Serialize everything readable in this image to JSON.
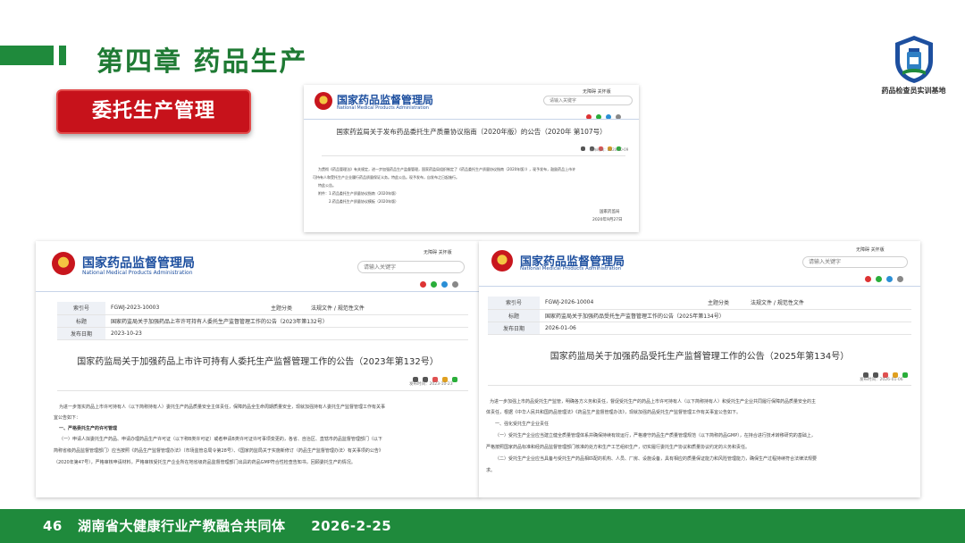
{
  "header": {
    "chapter_title": "第四章  药品生产",
    "section_label": "委托生产管理",
    "logo_caption": "药品检查员实训基地"
  },
  "nmpa": {
    "name_cn": "国家药品监督管理局",
    "name_en": "National Medical Products Administration",
    "toplinks": "无障碍  关怀版",
    "search_placeholder": "请输入关键字"
  },
  "doc1": {
    "title": "国家药监局关于发布药品委托生产质量协议指南（2020年版）的公告（2020年 第107号）",
    "publish_date": "发布时间：2020-10-09",
    "body": [
      "为贯彻《药品管理法》有关规定，进一步加强药品生产监督管理，国家药监局组织制定了《药品委托生产质量协议指南（2020年版）》，现予发布，鼓励药品上市许",
      "可持有人和受托生产企业履行药品质量保证义务。特此公告。现予发布，自发布之日起施行。",
      "特此公告。",
      "附件：1.药品委托生产质量协议指南（2020年版）",
      "2.药品委托生产质量协议模板（2020年版）"
    ],
    "sign_org": "国家药监局",
    "sign_date": "2020年9月27日"
  },
  "doc2": {
    "meta": {
      "index_label": "索引号",
      "index_value": "FGWJ-2023-10003",
      "category_label": "主题分类",
      "category_value": "法规文件 / 规范性文件",
      "title_label": "标题",
      "title_value": "国家药监局关于加强药品上市许可持有人委托生产监督管理工作的公告（2023年第132号）",
      "date_label": "发布日期",
      "date_value": "2023-10-23"
    },
    "title": "国家药监局关于加强药品上市许可持有人委托生产监督管理工作的公告（2023年第132号）",
    "publish_date": "发布时间：2023-10-23",
    "body": [
      "为进一步落实药品上市许可持有人（以下简称持有人）委托生产药品质量安全主体责任，保障药品全生命周期质量安全，现就加强持有人委托生产监督管理工作有关事",
      "宜公告如下：",
      "一、严格委托生产的许可管理",
      "（一）申请人拟委托生产药品、申请办理药品生产许可证（以下称B类许可证）或者申请B类许可证许可事项变更的，各省、自治区、直辖市药品监督管理部门（以下",
      "简称省级药品监督管理部门）应当按照《药品生产监督管理办法》（市场监管总局令第28号）、《国家药监局关于实施新修订〈药品生产监督管理办法〉有关事项的公告》",
      "（2020年第47号），严格审核申请材料，严格审核受托生产企业所在地省级药品监督管理部门出具的药品GMP符合性检查告知书，回顾委托生产的情况。"
    ]
  },
  "doc3": {
    "meta": {
      "index_label": "索引号",
      "index_value": "FGWJ-2026-10004",
      "category_label": "主题分类",
      "category_value": "法规文件 / 规范性文件",
      "title_label": "标题",
      "title_value": "国家药监局关于加强药品受托生产监督管理工作的公告（2025年第134号）",
      "date_label": "发布日期",
      "date_value": "2026-01-06"
    },
    "title": "国家药监局关于加强药品受托生产监督管理工作的公告（2025年第134号）",
    "publish_date": "发布时间：2026-01-06",
    "body": [
      "为进一步加强上市药品受托生产监管，明确各方义务和责任，督促受托生产的药品上市许可持有人（以下简称持有人）和受托生产企业共同履行保障药品质量安全的主",
      "体责任，根据《中华人民共和国药品管理法》《药品生产监督管理办法》，现就加强药品受托生产监督管理工作有关事宜公告如下。",
      "一、强化受托生产企业责任",
      "（一）受托生产企业应当建立健全质量管理体系并确保持续有效运行，严格遵守药品生产质量管理规范（以下简称药品GMP），在持合进行技术转移研究的基础上，",
      "严格按照国家药品标准和经药品监督管理部门核准的处方和生产工艺组织生产，切实履行委托生产协议和质量协议约定的义务和责任。",
      "（二）受托生产企业应当具备与受托生产药品相匹配的机构、人员、厂房、设施设备，具有相应的质量保证能力和风险管理能力，确保生产过程持续符合法律法规要",
      "求。"
    ]
  },
  "footer": {
    "page_number": "46",
    "org": "湖南省大健康行业产教融合共同体",
    "date": "2026-2-25"
  },
  "colors": {
    "green": "#1f8a3c",
    "red": "#c7121b",
    "nmpa_blue": "#1d4f9f"
  }
}
